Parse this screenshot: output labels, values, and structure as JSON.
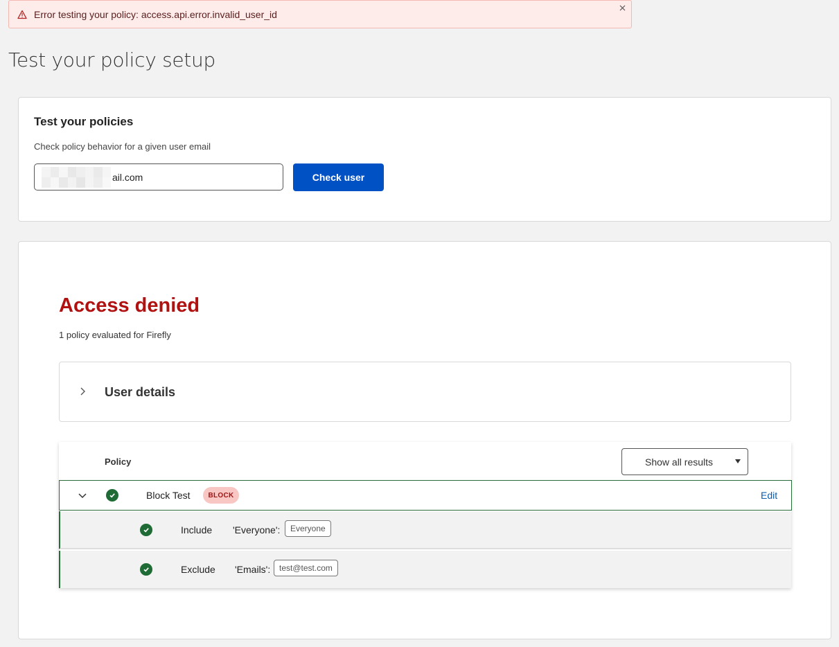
{
  "banner": {
    "message": "Error testing your policy: access.api.error.invalid_user_id"
  },
  "page": {
    "title": "Test your policy setup"
  },
  "test_card": {
    "heading": "Test your policies",
    "subtitle": "Check policy behavior for a given user email",
    "email_value_visible": "ail.com",
    "button_label": "Check user"
  },
  "result": {
    "title": "Access denied",
    "subtitle": "1 policy evaluated for Firefly",
    "user_details_label": "User details"
  },
  "policy_table": {
    "header_label": "Policy",
    "filter_label": "Show all results",
    "policy": {
      "name": "Block Test",
      "badge": "BLOCK",
      "edit_label": "Edit"
    },
    "rules": [
      {
        "kind": "Include",
        "key": "'Everyone':",
        "value": "Everyone"
      },
      {
        "kind": "Exclude",
        "key": "'Emails':",
        "value": "test@test.com"
      }
    ]
  },
  "colors": {
    "primary": "#0051c3",
    "denied": "#b01212",
    "success": "#1f6b35",
    "badge_bg": "#f8c7c4"
  }
}
